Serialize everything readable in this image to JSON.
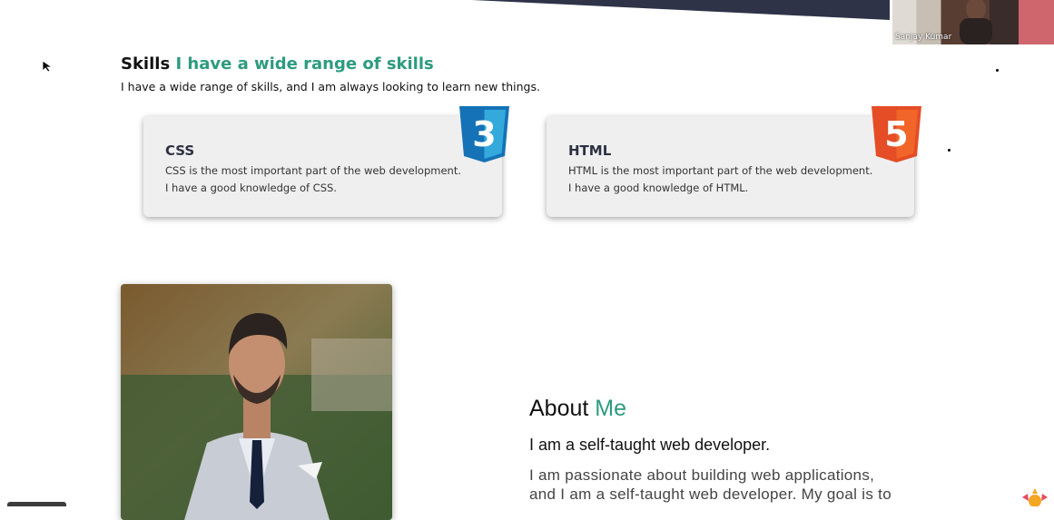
{
  "video": {
    "name": "Sanjay Kumar"
  },
  "skills": {
    "title_prefix": "Skills",
    "title_accent": "I have a wide range of skills",
    "subtitle": "I have a wide range of skills, and I am always looking to learn new things.",
    "cards": [
      {
        "title": "CSS",
        "line1": "CSS is the most important part of the web development.",
        "line2": "I have a good knowledge of CSS.",
        "badge_number": "3",
        "badge_color": "#1572b6",
        "icon": "css3-icon"
      },
      {
        "title": "HTML",
        "line1": "HTML is the most important part of the web development.",
        "line2": "I have a good knowledge of HTML.",
        "badge_number": "5",
        "badge_color": "#e44d26",
        "icon": "html5-icon"
      }
    ]
  },
  "about": {
    "title_prefix": "About",
    "title_accent": "Me",
    "subtitle": "I am a self-taught web developer.",
    "body_line1": "I am passionate about building web applications,",
    "body_line2": "and I am a self-taught web developer. My goal is to"
  },
  "colors": {
    "accent": "#2d9b7f",
    "banner": "#2e3348",
    "card_bg": "#f0eff0"
  }
}
